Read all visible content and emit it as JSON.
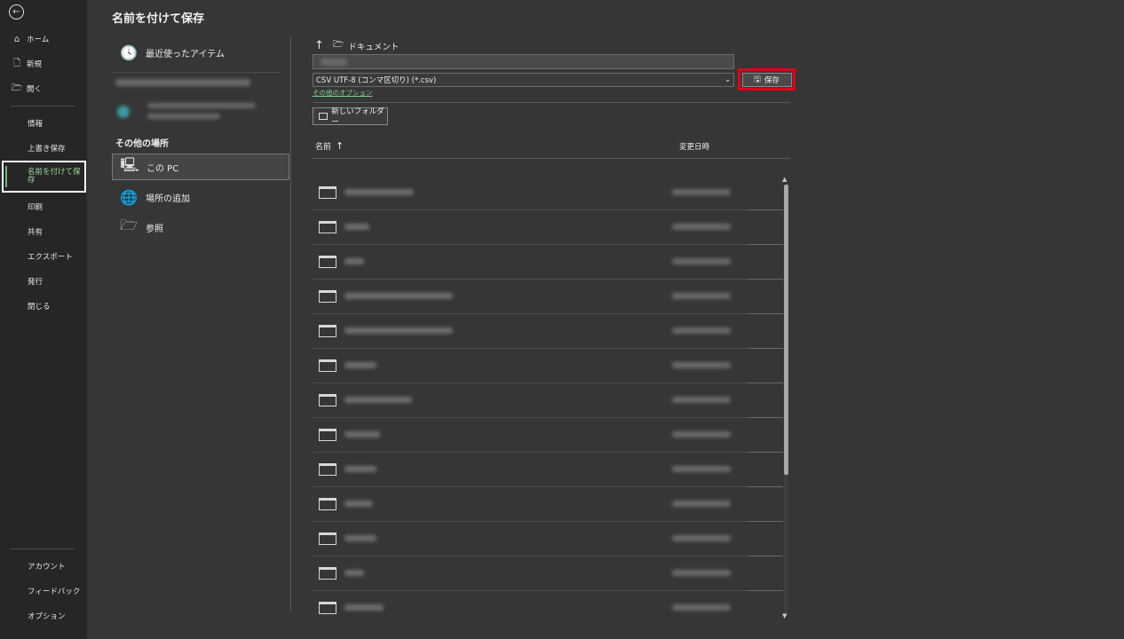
{
  "page_title": "名前を付けて保存",
  "nav": {
    "back_icon": "←",
    "top_items": [
      {
        "label": "ホーム",
        "icon": "⌂"
      },
      {
        "label": "新規",
        "icon": "🗋"
      },
      {
        "label": "開く",
        "icon": "🗁"
      }
    ],
    "mid_items": [
      "情報",
      "上書き保存",
      "名前を付けて保存",
      "印刷",
      "共有",
      "エクスポート",
      "発行",
      "閉じる"
    ],
    "selected_item": "名前を付けて保存",
    "bottom_items": [
      "アカウント",
      "フィードバック",
      "オプション"
    ]
  },
  "locations": {
    "recent": "最近使ったアイテム",
    "other_places_heading": "その他の場所",
    "this_pc": "この PC",
    "add_place": "場所の追加",
    "browse": "参照"
  },
  "breadcrumb": {
    "folder": "ドキュメント"
  },
  "file_type": "CSV UTF-8 (コンマ区切り) (*.csv)",
  "more_options": "その他のオプション",
  "save_label": "保存",
  "new_folder": "新しいフォルダー",
  "columns": {
    "name": "名前",
    "date": "変更日時"
  },
  "colors": {
    "accent": "#7ed38a",
    "highlight": "#e0001a"
  }
}
